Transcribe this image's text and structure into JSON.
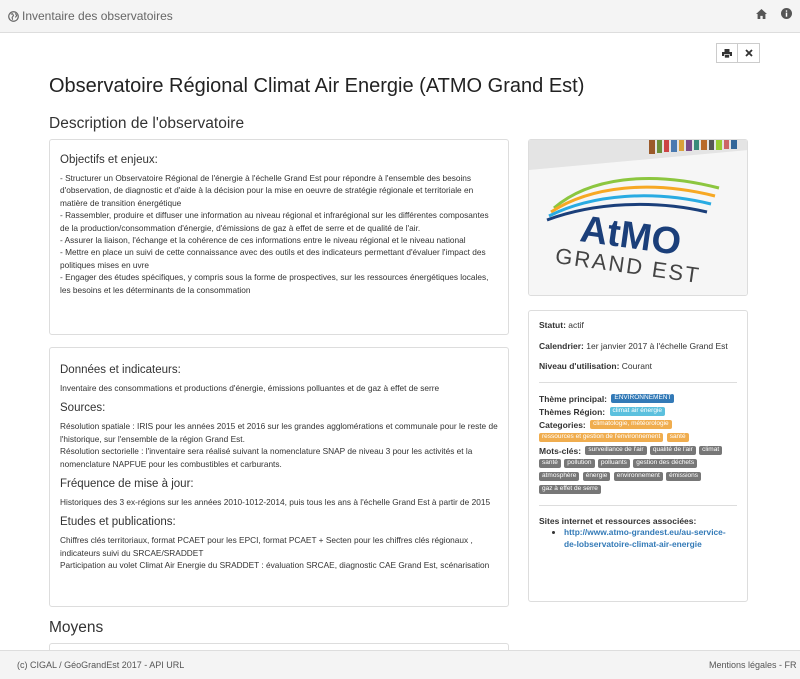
{
  "header": {
    "title": "Inventaire des observatoires"
  },
  "page": {
    "title": "Observatoire Régional Climat Air Energie (ATMO Grand Est)"
  },
  "sections": {
    "description": "Description de l'observatoire",
    "moyens": "Moyens"
  },
  "objectifs": {
    "heading": "Objectifs et enjeux:",
    "text": "- Structurer un Observatoire Régional de l'énergie à l'échelle Grand Est pour répondre à l'ensemble des besoins d'observation, de diagnostic et d'aide à la décision pour la mise en oeuvre de stratégie régionale et territoriale en matière de transition énergétique\n- Rassembler, produire et diffuser une information au niveau régional et infrarégional sur les différentes composantes de la production/consommation d'énergie, d'émissions de gaz à effet de serre et de qualité de l'air.\n- Assurer la liaison, l'échange et la cohérence de ces informations entre le niveau régional et le niveau national\n- Mettre en place un suivi de cette connaissance avec des outils et des indicateurs permettant d'évaluer l'impact des politiques mises en uvre\n- Engager des études spécifiques, y compris sous la forme de prospectives, sur les ressources énergétiques locales, les besoins et les déterminants de la consommation"
  },
  "donnees": {
    "heading": "Données et indicateurs:",
    "text": "Inventaire des consommations et productions d'énergie, émissions polluantes et de gaz à effet de serre",
    "sources_heading": "Sources:",
    "sources_text": "Résolution spatiale : IRIS pour les années 2015 et 2016 sur les grandes agglomérations et communale pour le reste de l'historique, sur l'ensemble de la région Grand Est.\nRésolution sectorielle : l'inventaire sera réalisé suivant la nomenclature SNAP de niveau 3 pour les activités et la nomenclature NAPFUE pour les combustibles et carburants.",
    "frequence_heading": "Fréquence de mise à jour:",
    "frequence_text": "Historiques des 3 ex-régions sur les années 2010-1012-2014, puis tous les ans à l'échelle Grand Est à partir de 2015",
    "etudes_heading": "Etudes et publications:",
    "etudes_text": "Chiffres clés territoriaux, format PCAET pour les EPCI, format PCAET + Secten pour les chiffres clés régionaux , indicateurs suivi du SRCAE/SRADDET\nParticipation au volet Climat Air Energie du SRADDET : évaluation SRCAE, diagnostic CAE Grand Est, scénarisation"
  },
  "logo": {
    "text_top": "AtMO",
    "text_bottom": "GRAND EST"
  },
  "side": {
    "statut_label": "Statut:",
    "statut_value": "actif",
    "calendrier_label": "Calendrier:",
    "calendrier_value": "1er janvier 2017 à l'échelle Grand Est",
    "niveau_label": "Niveau d'utilisation:",
    "niveau_value": "Courant",
    "theme_principal_label": "Thème principal:",
    "theme_principal": "ENVIRONNEMENT",
    "themes_region_label": "Thèmes Région:",
    "themes_region": "climat  air  énergie",
    "categories_label": "Categories:",
    "categories": [
      "climatologie, météorologie",
      "ressources et gestion de l'environnement",
      "santé"
    ],
    "mots_cles_label": "Mots-clés:",
    "mots_cles": [
      "surveillance de l'air",
      "qualité de l'air",
      "climat",
      "santé",
      "pollution",
      "polluants",
      "gestion des déchets",
      "atmosphère",
      "énergie",
      "environnement",
      "émissions",
      "gaz à effet de serre"
    ],
    "sites_label": "Sites internet et ressources associées:",
    "site_link": "http://www.atmo-grandest.eu/au-service-de-lobservatoire-climat-air-energie"
  },
  "footer": {
    "left": "(c) CIGAL / GéoGrandEst 2017 - API URL",
    "right": "Mentions légales - FR"
  },
  "colors": {
    "primary": "#337ab7",
    "info": "#5bc0de",
    "warning": "#f0ad4e",
    "default": "#777777"
  }
}
